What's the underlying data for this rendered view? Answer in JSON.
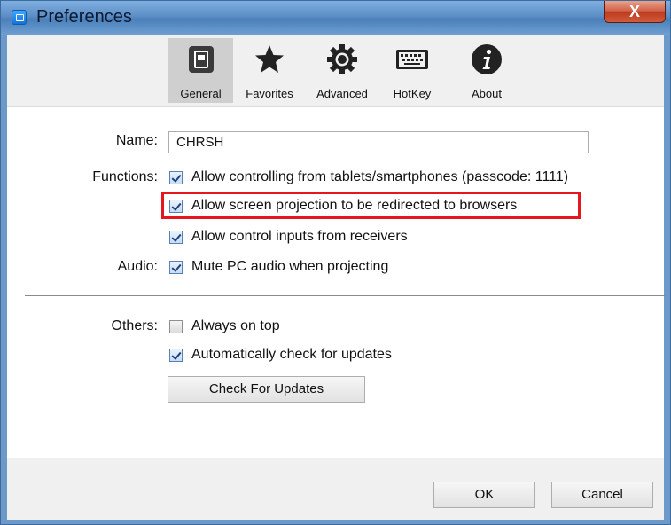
{
  "window": {
    "title": "Preferences",
    "close_label": "X"
  },
  "toolbar": {
    "tabs": [
      {
        "label": "General",
        "icon": "general-icon",
        "selected": true
      },
      {
        "label": "Favorites",
        "icon": "star-icon",
        "selected": false
      },
      {
        "label": "Advanced",
        "icon": "gear-icon",
        "selected": false
      },
      {
        "label": "HotKey",
        "icon": "keyboard-icon",
        "selected": false
      },
      {
        "label": "About",
        "icon": "info-icon",
        "selected": false
      }
    ]
  },
  "form": {
    "name_label": "Name:",
    "name_value": "CHRSH",
    "functions_label": "Functions:",
    "functions": [
      {
        "label": "Allow controlling from tablets/smartphones (passcode: 1111)",
        "checked": true
      },
      {
        "label": "Allow screen projection to be redirected to browsers",
        "checked": true
      },
      {
        "label": "Allow control inputs from receivers",
        "checked": true
      }
    ],
    "audio_label": "Audio:",
    "audio": {
      "label": "Mute PC audio when projecting",
      "checked": true
    },
    "others_label": "Others:",
    "others": [
      {
        "label": "Always on top",
        "checked": false
      },
      {
        "label": "Automatically check for updates",
        "checked": true
      }
    ],
    "check_updates_button": "Check For Updates"
  },
  "footer": {
    "ok": "OK",
    "cancel": "Cancel"
  },
  "colors": {
    "highlight": "#e5161d",
    "titlebar": "#5d8fc6",
    "close": "#c44a2c"
  }
}
